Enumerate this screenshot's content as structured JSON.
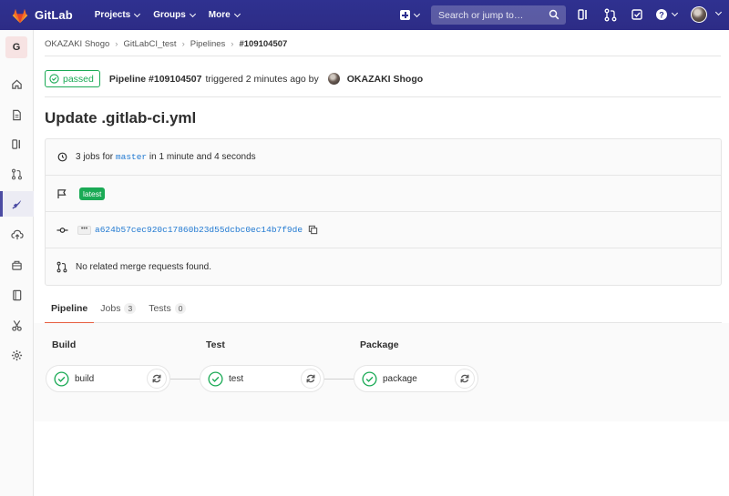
{
  "navbar": {
    "brand": "GitLab",
    "menu": [
      "Projects",
      "Groups",
      "More"
    ],
    "search_placeholder": "Search or jump to…",
    "brand_color": "#e24329",
    "bg_color": "#2f3190"
  },
  "sidebar": {
    "project_initial": "G",
    "items": [
      "home-icon",
      "file-icon",
      "issues-icon",
      "merge-request-icon",
      "rocket-icon",
      "cloud-upload-icon",
      "package-icon",
      "book-icon",
      "scissors-icon",
      "gear-icon"
    ],
    "active_index": 4
  },
  "breadcrumb": [
    "OKAZAKI Shogo",
    "GitLabCI_test",
    "Pipelines",
    "#109104507"
  ],
  "header": {
    "status": "passed",
    "pipeline": "Pipeline #109104507",
    "triggered": "triggered 2 minutes ago by",
    "user": "OKAZAKI Shogo"
  },
  "title": "Update .gitlab-ci.yml",
  "info": {
    "jobs_prefix": "3 jobs for",
    "branch": "master",
    "jobs_suffix": "in 1 minute and 4 seconds",
    "latest_badge": "latest",
    "ellipsis": "•••",
    "sha": "a624b57cec920c17860b23d55dcbc0ec14b7f9de",
    "merge_requests": "No related merge requests found."
  },
  "tabs": [
    {
      "label": "Pipeline",
      "count": null
    },
    {
      "label": "Jobs",
      "count": "3"
    },
    {
      "label": "Tests",
      "count": "0"
    }
  ],
  "stages": [
    {
      "name": "Build",
      "job": "build"
    },
    {
      "name": "Test",
      "job": "test"
    },
    {
      "name": "Package",
      "job": "package"
    }
  ],
  "colors": {
    "success": "#1aaa55",
    "link": "#1f78d1",
    "active_tab": "#e75e40"
  }
}
